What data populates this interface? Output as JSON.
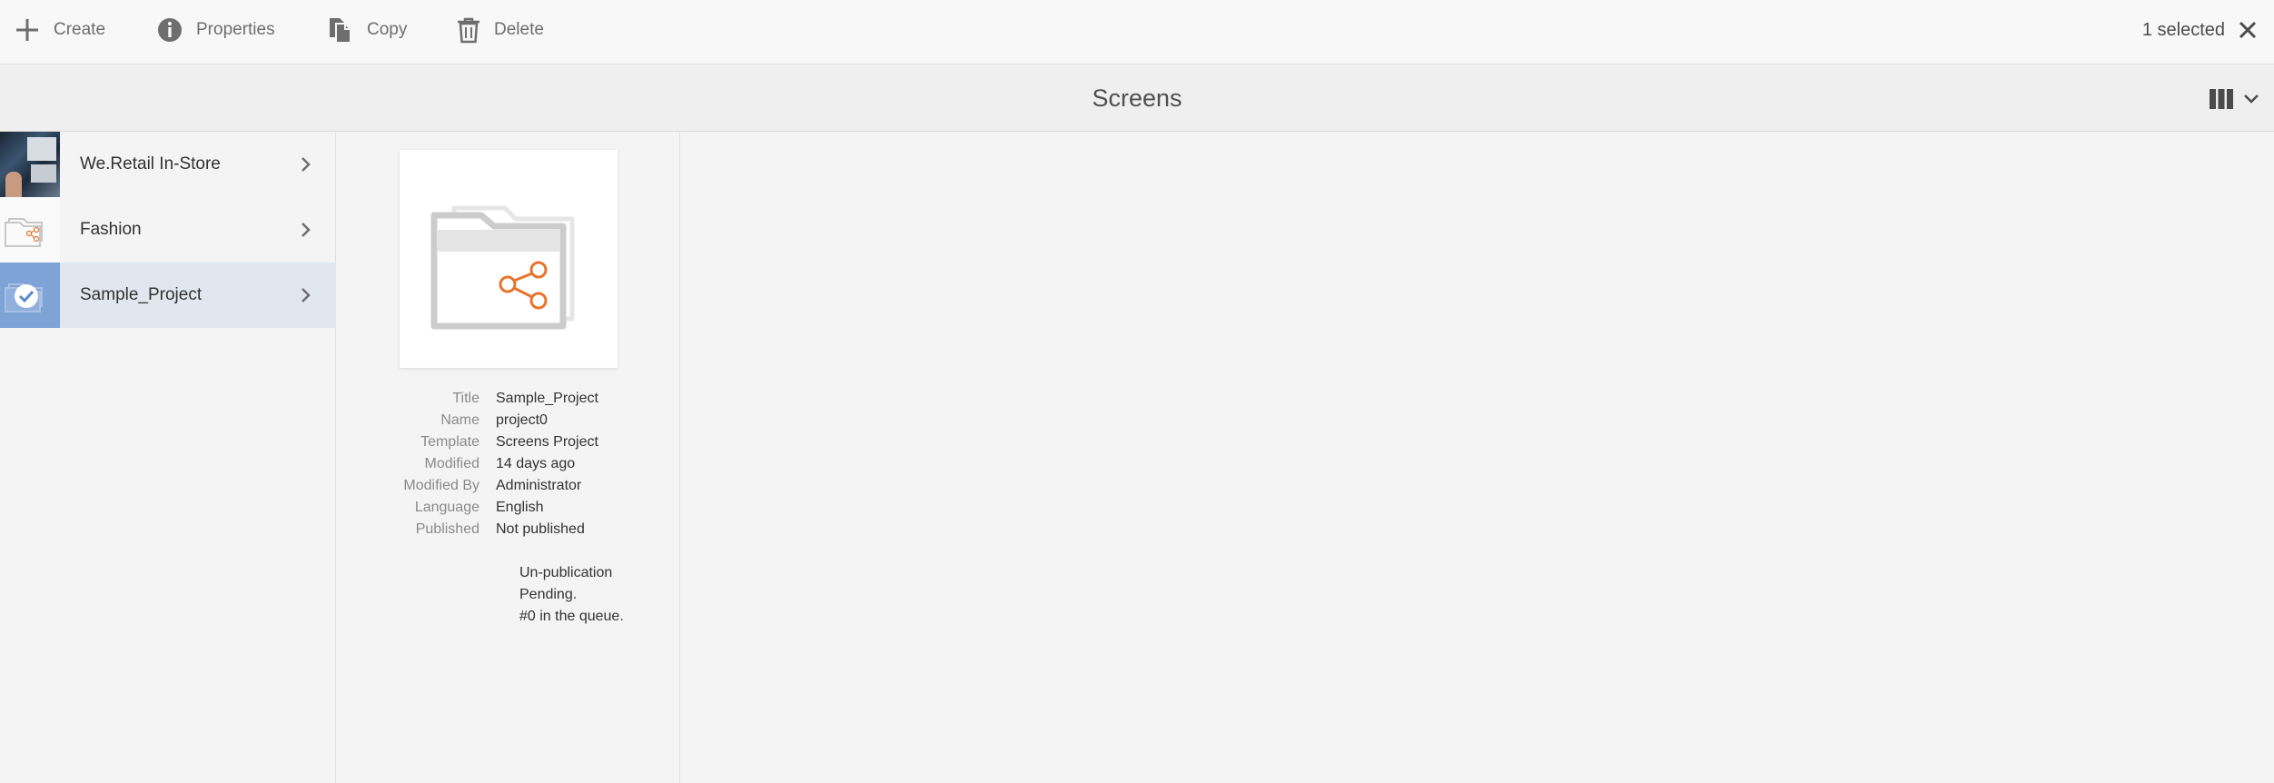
{
  "actionbar": {
    "create": "Create",
    "properties": "Properties",
    "copy": "Copy",
    "delete": "Delete",
    "selected_count": "1 selected"
  },
  "title": "Screens",
  "icons": {
    "create": "plus-icon",
    "properties": "info-icon",
    "copy": "copy-icon",
    "delete": "trash-icon",
    "close": "close-icon",
    "view": "column-view-icon",
    "chevron": "chevron-right-icon"
  },
  "colors": {
    "selected_row": "#e2e7ef",
    "selected_thumb": "#7ea3d6",
    "accent_orange": "#e8742c"
  },
  "column1": {
    "items": [
      {
        "label": "We.Retail In-Store",
        "selected": false
      },
      {
        "label": "Fashion",
        "selected": false
      },
      {
        "label": "Sample_Project",
        "selected": true
      }
    ]
  },
  "column2": {
    "meta": [
      {
        "key": "Title",
        "value": "Sample_Project"
      },
      {
        "key": "Name",
        "value": "project0"
      },
      {
        "key": "Template",
        "value": "Screens Project"
      },
      {
        "key": "Modified",
        "value": "14 days ago"
      },
      {
        "key": "Modified By",
        "value": "Administrator"
      },
      {
        "key": "Language",
        "value": "English"
      },
      {
        "key": "Published",
        "value": "Not published"
      }
    ],
    "note": [
      "Un-publication",
      "Pending.",
      "#0 in the queue."
    ]
  }
}
